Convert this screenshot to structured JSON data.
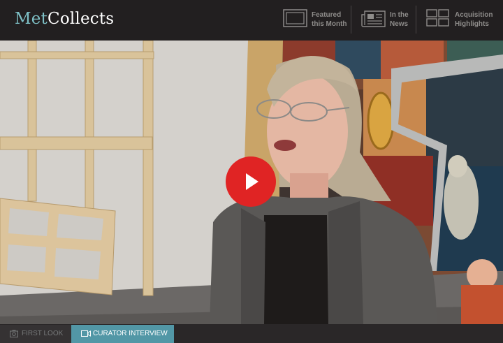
{
  "brand": {
    "prefix": "Met",
    "suffix": "Collects"
  },
  "nav": [
    {
      "line1": "Featured",
      "line2": "this Month",
      "icon": "monitor-icon"
    },
    {
      "line1": "In the",
      "line2": "News",
      "icon": "newspaper-icon"
    },
    {
      "line1": "Acquisition",
      "line2": "Highlights",
      "icon": "grid-icon"
    }
  ],
  "video": {
    "play_icon": "play-icon"
  },
  "tabs": [
    {
      "label": "FIRST LOOK",
      "icon": "camera-icon",
      "active": false
    },
    {
      "label": "CURATOR INTERVIEW",
      "icon": "video-camera-icon",
      "active": true
    }
  ],
  "colors": {
    "brand_accent": "#7ec0c6",
    "header_bg": "#221f20",
    "active_tab": "#5297a6",
    "play_button": "#e02424"
  }
}
